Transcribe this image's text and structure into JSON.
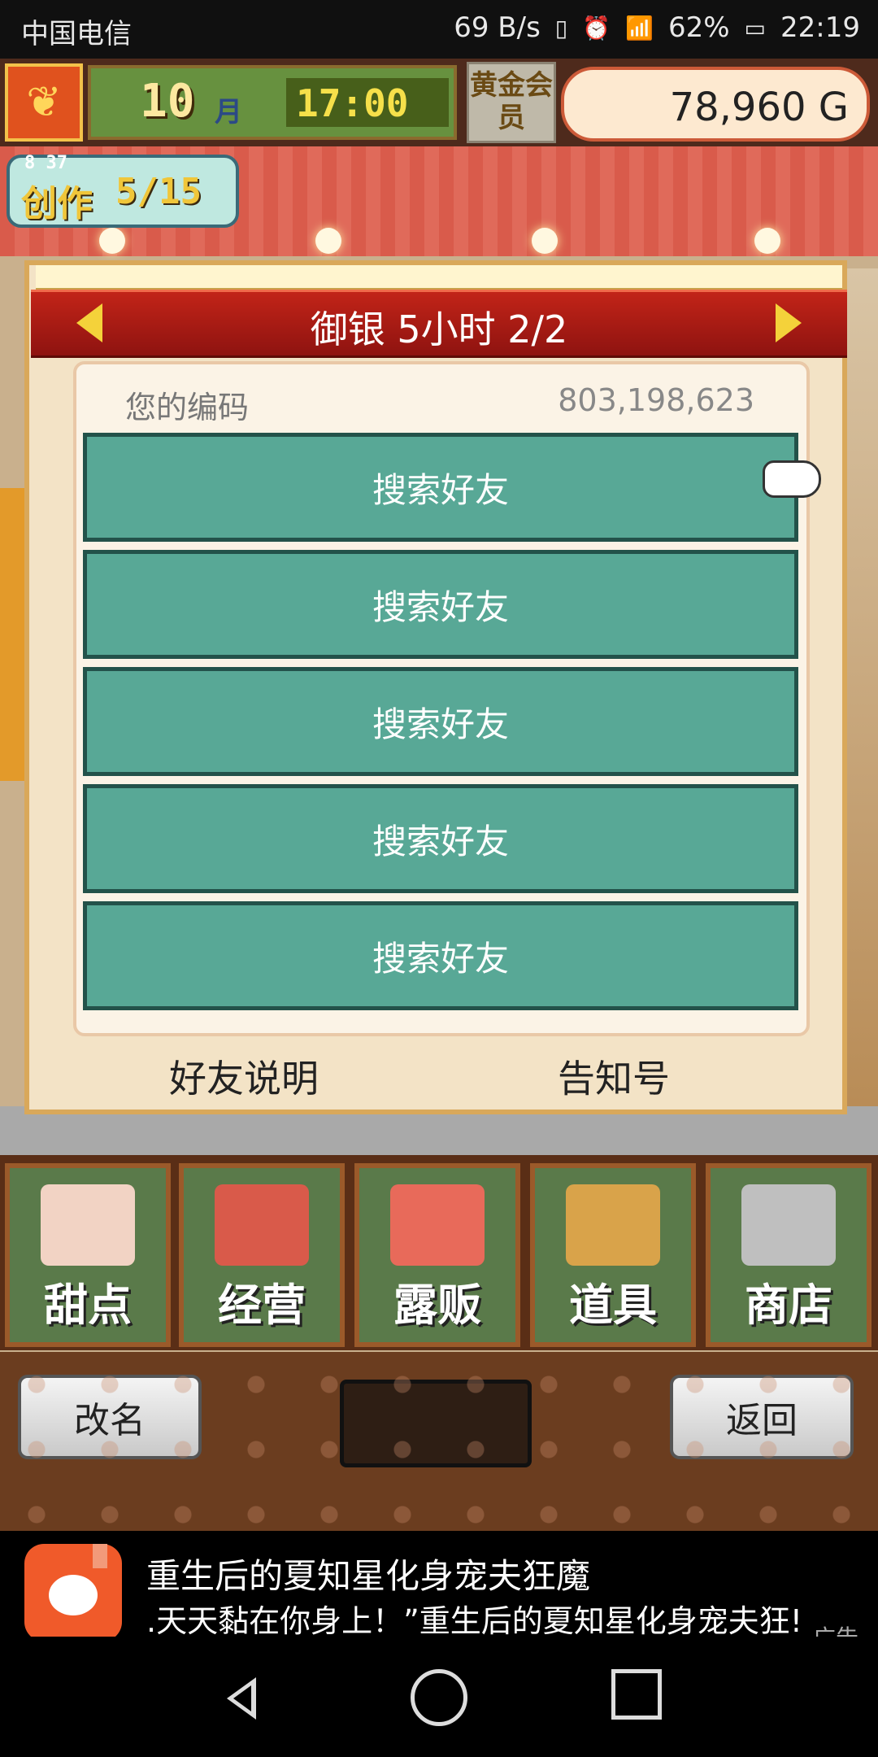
{
  "status": {
    "carrier": "中国电信",
    "speed": "69 B/s",
    "battery": "62%",
    "time": "22:19"
  },
  "hud": {
    "month": "10",
    "month_label": "月",
    "time": "17:00",
    "member_badge": "黄金会员",
    "money": "78,960 G",
    "create_label": "创作",
    "create_count": "5/15",
    "create_sub": "8 37"
  },
  "dialog": {
    "title": "御银  5小时 2/2",
    "code_label": "您的编码",
    "code_value": "803,198,623",
    "buttons": [
      "搜索好友",
      "搜索好友",
      "搜索好友",
      "搜索好友",
      "搜索好友"
    ],
    "footer_left": "好友说明",
    "footer_right": "告知号"
  },
  "menu": {
    "items": [
      {
        "label": "甜点",
        "icon": "cake-icon",
        "color": "#f2d3c4"
      },
      {
        "label": "经营",
        "icon": "shop-icon",
        "color": "#d95a4a"
      },
      {
        "label": "露贩",
        "icon": "food-truck-icon",
        "color": "#e86a5a"
      },
      {
        "label": "道具",
        "icon": "items-bag-icon",
        "color": "#d9a34a"
      },
      {
        "label": "商店",
        "icon": "shopping-cart-icon",
        "color": "#bfbfbf"
      }
    ]
  },
  "bottom": {
    "rename": "改名",
    "back": "返回"
  },
  "ad": {
    "title": "重生后的夏知星化身宠夫狂魔",
    "subtitle": ".天天黏在你身上！”重生后的夏知星化身宠夫狂!",
    "tag": "广告"
  }
}
